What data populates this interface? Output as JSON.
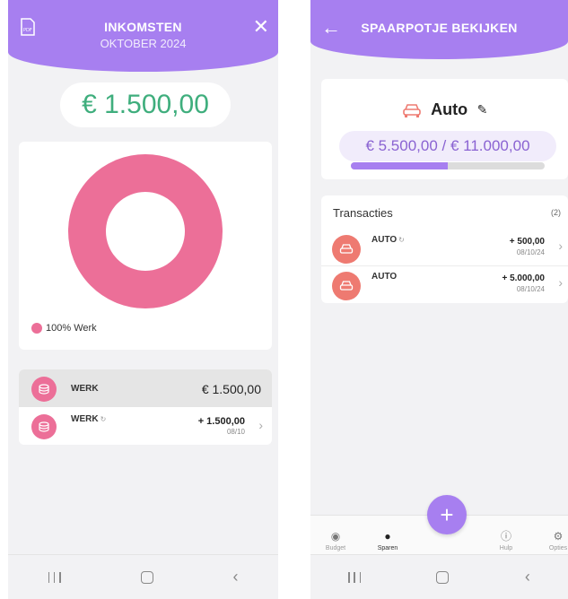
{
  "income_screen": {
    "title": "INKOMSTEN",
    "subtitle": "OKTOBER 2024",
    "total": "€ 1.500,00",
    "legend": "100% Werk",
    "rows": [
      {
        "label": "WERK",
        "value": "€ 1.500,00"
      },
      {
        "label": "WERK",
        "amount": "+ 1.500,00",
        "date": "08/10"
      }
    ],
    "colors": {
      "header": "#a77ff0",
      "slice": "#ec6f98",
      "total": "#3fae7d"
    }
  },
  "savings_screen": {
    "title": "SPAARPOTJE BEKIJKEN",
    "pot_name": "Auto",
    "progress_text": "€ 5.500,00 / € 11.000,00",
    "progress_fraction": 0.5,
    "transactions_title": "Transacties",
    "transactions_count": "(2)",
    "transactions": [
      {
        "label": "AUTO",
        "amount": "+ 500,00",
        "date": "08/10/24"
      },
      {
        "label": "AUTO",
        "amount": "+ 5.000,00",
        "date": "08/10/24"
      }
    ],
    "fab_label": "+",
    "tabs": [
      {
        "label": "Budget",
        "icon": "eye-icon"
      },
      {
        "label": "Sparen",
        "icon": "piggy-bank-icon"
      },
      {
        "label": "Hulp",
        "icon": "help-icon"
      },
      {
        "label": "Opties",
        "icon": "gear-icon"
      }
    ]
  },
  "chart_data": {
    "type": "pie",
    "categories": [
      "Werk"
    ],
    "values": [
      100
    ],
    "legend": [
      "100% Werk"
    ]
  }
}
